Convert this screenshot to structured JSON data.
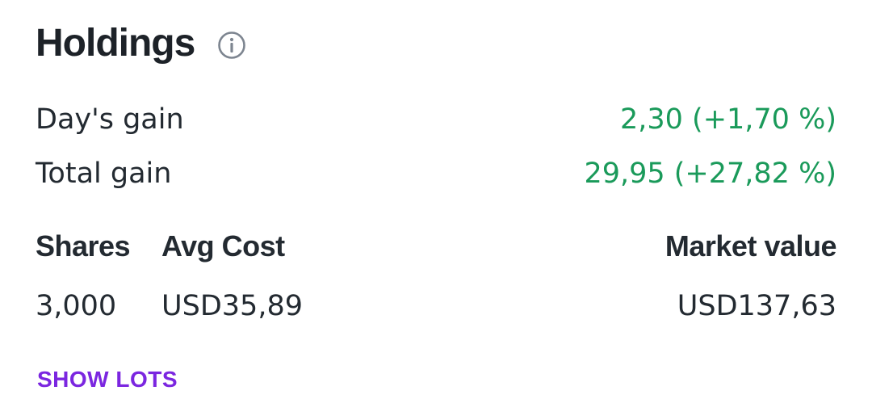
{
  "holdings": {
    "title": "Holdings",
    "info_icon": "info-icon",
    "days_gain": {
      "label": "Day's gain",
      "value": "2,30 (+1,70 %)"
    },
    "total_gain": {
      "label": "Total gain",
      "value": "29,95 (+27,82 %)"
    },
    "columns": {
      "shares": "Shares",
      "avg_cost": "Avg Cost",
      "market_value": "Market value"
    },
    "values": {
      "shares": "3,000",
      "avg_cost": "USD35,89",
      "market_value": "USD137,63"
    },
    "show_lots": "SHOW LOTS"
  },
  "colors": {
    "gain": "#1a9a5a",
    "link": "#7b26e0",
    "text": "#232a31"
  }
}
